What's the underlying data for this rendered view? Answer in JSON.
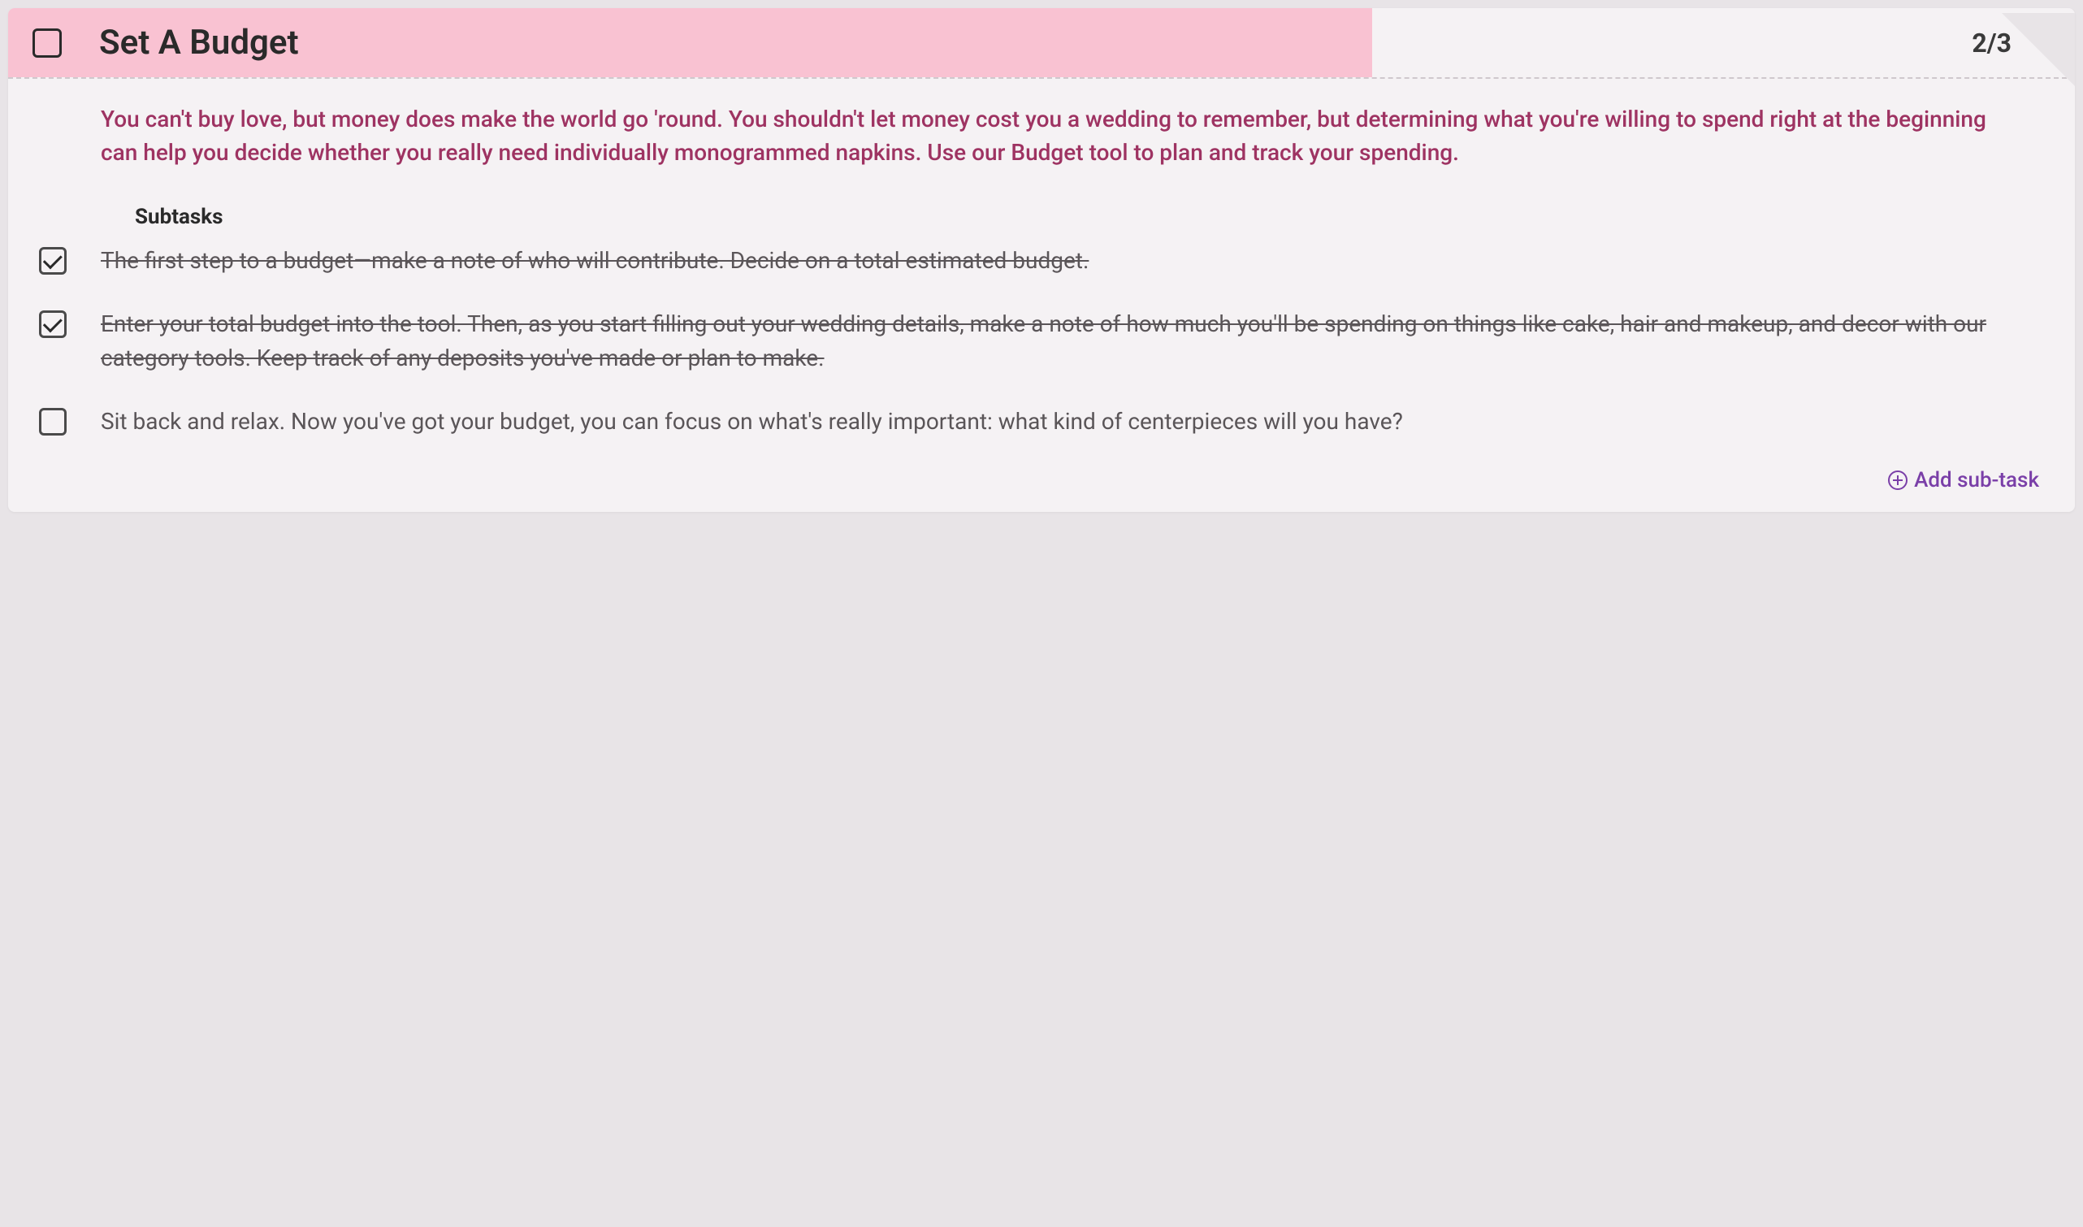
{
  "task": {
    "title": "Set A Budget",
    "counter": "2/3",
    "description": "You can't buy love, but money does make the world go 'round. You shouldn't let money cost you a wedding to remember, but determining what you're willing to spend right at the beginning can help you decide whether you really need individually monogrammed napkins. Use our Budget tool to plan and track your spending.",
    "subtasks_heading": "Subtasks",
    "subtasks": [
      {
        "text": "The first step to a budget—make a note of who will contribute. Decide on a total estimated budget.",
        "completed": true
      },
      {
        "text": "Enter your total budget into the tool. Then, as you start filling out your wedding details, make a note of how much you'll be spending on things like cake, hair and makeup, and decor with our category tools. Keep track of any deposits you've made or plan to make.",
        "completed": true
      },
      {
        "text": "Sit back and relax. Now you've got your budget, you can focus on what's really important: what kind of centerpieces will you have?",
        "completed": false
      }
    ],
    "add_subtask_label": "Add sub-task"
  }
}
